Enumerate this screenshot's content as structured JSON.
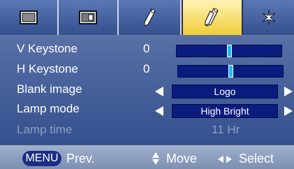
{
  "tabs": [
    {
      "icon": "picture-icon",
      "active": false
    },
    {
      "icon": "screen-icon",
      "active": false
    },
    {
      "icon": "hand-tool-icon",
      "active": false
    },
    {
      "icon": "hands-tool-icon",
      "active": true
    },
    {
      "icon": "star-icon",
      "active": false
    }
  ],
  "menu": {
    "v_keystone": {
      "label": "V Keystone",
      "value": "0",
      "slider_level": 0.5
    },
    "h_keystone": {
      "label": "H Keystone",
      "value": "0",
      "slider_level": 0.5
    },
    "blank_image": {
      "label": "Blank image",
      "value": "Logo"
    },
    "lamp_mode": {
      "label": "Lamp mode",
      "value": "High Bright"
    },
    "lamp_time": {
      "label": "Lamp time",
      "value": "11 Hr",
      "disabled": true
    }
  },
  "hints": {
    "menu_key": "MENU",
    "prev": "Prev.",
    "move": "Move",
    "select": "Select"
  },
  "colors": {
    "menu_bg": "#34508e",
    "active_tab": "#f0cd3a",
    "slider_track": "#0c1c7e",
    "slider_thumb": "#15c0f0",
    "disabled_text": "#8f9fc3"
  }
}
